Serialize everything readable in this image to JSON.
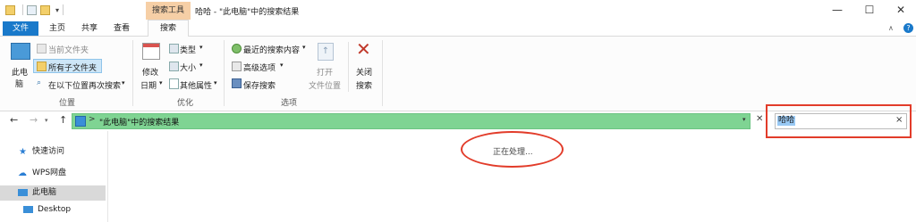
{
  "window": {
    "title": "哈哈 - \"此电脑\"中的搜索结果",
    "contextual_tab_group": "搜索工具",
    "minimize": "—",
    "maximize": "☐",
    "close": "✕"
  },
  "ribbon_tabs": [
    "文件",
    "主页",
    "共享",
    "查看",
    "搜索"
  ],
  "ribbon": {
    "location": {
      "this_pc_l1": "此电",
      "this_pc_l2": "脑",
      "current_folder": "当前文件夹",
      "all_subfolders": "所有子文件夹",
      "search_again_in": "在以下位置再次搜索",
      "group_label": "位置"
    },
    "refine": {
      "modified_l1": "修改",
      "modified_l2": "日期",
      "kind": "类型",
      "size": "大小",
      "other_props": "其他属性",
      "group_label": "优化"
    },
    "options": {
      "recent_searches": "最近的搜索内容",
      "advanced_options": "高级选项",
      "save_search": "保存搜索",
      "open_location_l1": "打开",
      "open_location_l2": "文件位置",
      "close_search_l1": "关闭",
      "close_search_l2": "搜索",
      "group_label": "选项"
    }
  },
  "address": {
    "separator": ">",
    "path": "\"此电脑\"中的搜索结果"
  },
  "search": {
    "query": "哈哈",
    "clear": "×"
  },
  "nav": {
    "back": "←",
    "forward": "→",
    "up": "↑",
    "items": [
      "快速访问",
      "WPS网盘",
      "此电脑",
      "Desktop"
    ]
  },
  "content": {
    "status": "正在处理..."
  },
  "colors": {
    "file_tab": "#1979ca",
    "context_tab": "#f6cfa6",
    "address_highlight": "#7fd493",
    "annotation_red": "#e23c2a"
  }
}
